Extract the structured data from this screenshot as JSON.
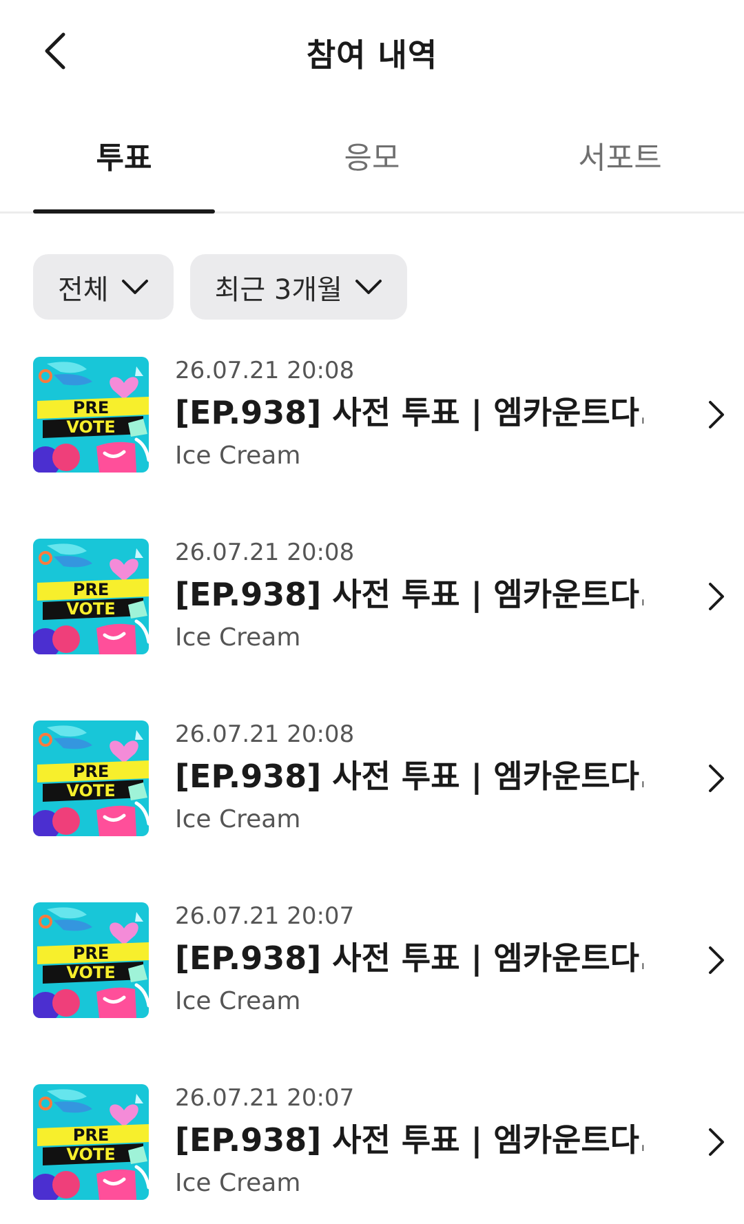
{
  "header": {
    "title": "참여 내역"
  },
  "tabs": [
    {
      "label": "투표",
      "active": true
    },
    {
      "label": "응모",
      "active": false
    },
    {
      "label": "서포트",
      "active": false
    }
  ],
  "filters": [
    {
      "label": "전체"
    },
    {
      "label": "최근 3개월"
    }
  ],
  "items": [
    {
      "date": "26.07.21 20:08",
      "title": "[EP.938] 사전 투표 | 엠카운트다...",
      "sub": "Ice Cream",
      "thumb": {
        "line1": "PRE",
        "line2": "VOTE"
      }
    },
    {
      "date": "26.07.21 20:08",
      "title": "[EP.938] 사전 투표 | 엠카운트다...",
      "sub": "Ice Cream",
      "thumb": {
        "line1": "PRE",
        "line2": "VOTE"
      }
    },
    {
      "date": "26.07.21 20:08",
      "title": "[EP.938] 사전 투표 | 엠카운트다...",
      "sub": "Ice Cream",
      "thumb": {
        "line1": "PRE",
        "line2": "VOTE"
      }
    },
    {
      "date": "26.07.21 20:07",
      "title": "[EP.938] 사전 투표 | 엠카운트다...",
      "sub": "Ice Cream",
      "thumb": {
        "line1": "PRE",
        "line2": "VOTE"
      }
    },
    {
      "date": "26.07.21 20:07",
      "title": "[EP.938] 사전 투표 | 엠카운트다...",
      "sub": "Ice Cream",
      "thumb": {
        "line1": "PRE",
        "line2": "VOTE"
      }
    }
  ],
  "colors": {
    "thumb_bg": "#18c6d8",
    "thumb_band_yellow": "#f7ef2c",
    "thumb_band_black": "#111111",
    "heart": "#f48bd8",
    "ball_pink": "#ef3f7a",
    "ball_purple": "#4b2fd0"
  }
}
